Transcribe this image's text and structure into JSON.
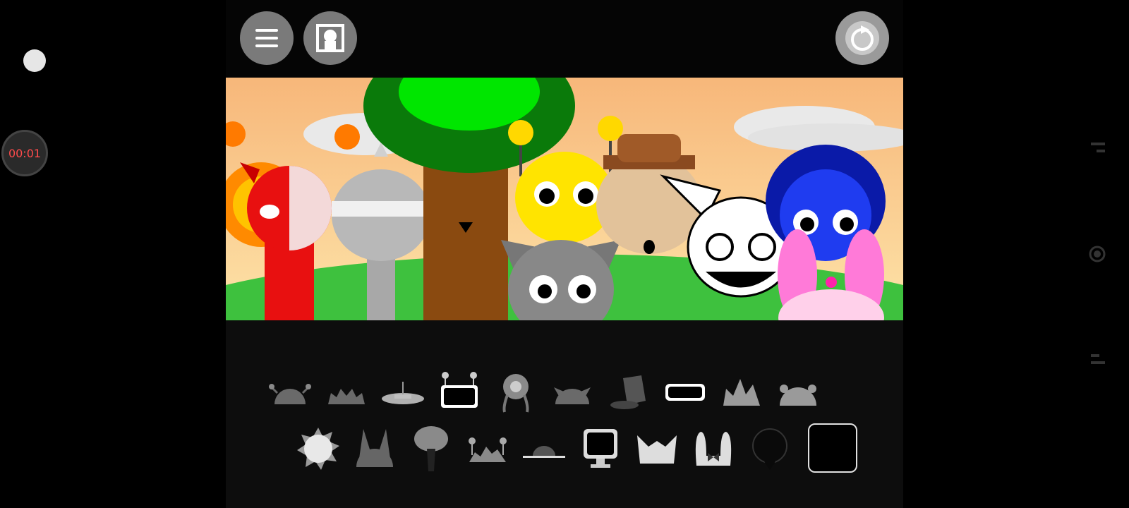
{
  "recording": {
    "timer": "00:01",
    "color": "#ff4b4b"
  },
  "icons": {
    "menu": "hamburger-icon",
    "character": "character-portrait-icon",
    "reset": "reset-icon",
    "mute": "mute-icon",
    "solo": "headphones-icon",
    "remove": "close-icon"
  },
  "palette": {
    "row1": [
      "horns-dome-icon",
      "spiky-dome-icon",
      "saucer-hat-icon",
      "antenna-screen-icon",
      "flower-icon",
      "pointed-ears-dome-icon",
      "top-hat-icon",
      "goggles-icon",
      "crown-spikes-icon",
      "round-ears-dome-icon"
    ],
    "row2": [
      "sun-icon",
      "cat-ears-icon",
      "tree-icon",
      "antenna-crab-icon",
      "bowler-hat-icon",
      "monitor-icon",
      "crown-ears-icon",
      "bunny-ears-bow-icon",
      "black-ball-icon",
      "empty-slot"
    ]
  },
  "colors": {
    "sky_top": "#f7b77a",
    "sky_bottom": "#fde3a8",
    "grass": "#3ec13e",
    "button": "#7a7a7a"
  }
}
